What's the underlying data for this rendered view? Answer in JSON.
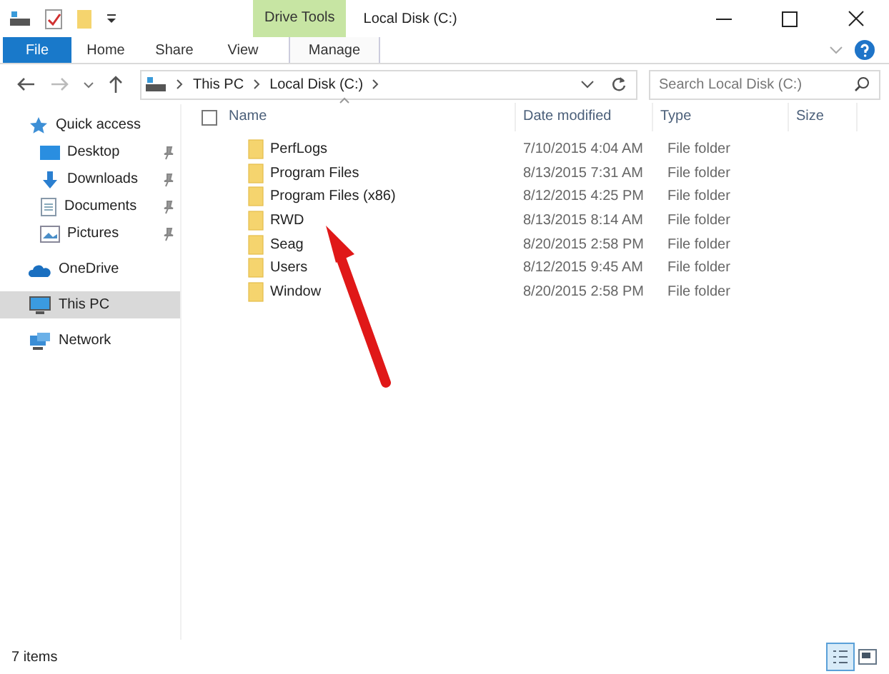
{
  "window": {
    "title": "Local Disk (C:)",
    "context_tab": "Drive Tools"
  },
  "ribbon_tabs": [
    {
      "label": "File",
      "selected": true
    },
    {
      "label": "Home",
      "selected": false
    },
    {
      "label": "Share",
      "selected": false
    },
    {
      "label": "View",
      "selected": false
    },
    {
      "label": "Manage",
      "selected": false
    }
  ],
  "address": {
    "crumbs": [
      "This PC",
      "Local Disk (C:)"
    ]
  },
  "search": {
    "placeholder": "Search Local Disk (C:)"
  },
  "sidebar": {
    "items": [
      {
        "label": "Quick access",
        "kind": "star",
        "pinned": false,
        "selected": false
      },
      {
        "label": "Desktop",
        "kind": "desktop",
        "pinned": true,
        "selected": false
      },
      {
        "label": "Downloads",
        "kind": "download",
        "pinned": true,
        "selected": false
      },
      {
        "label": "Documents",
        "kind": "document",
        "pinned": true,
        "selected": false
      },
      {
        "label": "Pictures",
        "kind": "pictures",
        "pinned": true,
        "selected": false
      },
      {
        "label": "OneDrive",
        "kind": "cloud",
        "pinned": false,
        "selected": false
      },
      {
        "label": "This PC",
        "kind": "pc",
        "pinned": false,
        "selected": true
      },
      {
        "label": "Network",
        "kind": "network",
        "pinned": false,
        "selected": false
      }
    ]
  },
  "table": {
    "select_all": {
      "checked": false
    },
    "columns": [
      "Name",
      "Date modified",
      "Type",
      "Size"
    ],
    "rows": [
      {
        "name": "PerfLogs",
        "date": "7/10/2015 4:04 AM",
        "type": "File folder"
      },
      {
        "name": "Program Files",
        "date": "8/13/2015 7:31 AM",
        "type": "File folder"
      },
      {
        "name": "Program Files (x86)",
        "date": "8/12/2015 4:25 PM",
        "type": "File folder"
      },
      {
        "name": "RWD",
        "date": "8/13/2015 8:14 AM",
        "type": "File folder"
      },
      {
        "name": "Seag",
        "date": "8/20/2015 2:58 PM",
        "type": "File folder"
      },
      {
        "name": "Users",
        "date": "8/12/2015 9:45 AM",
        "type": "File folder"
      },
      {
        "name": "Window",
        "date": "8/20/2015 2:58 PM",
        "type": "File folder"
      }
    ]
  },
  "status_bar": {
    "count": "7 items"
  }
}
